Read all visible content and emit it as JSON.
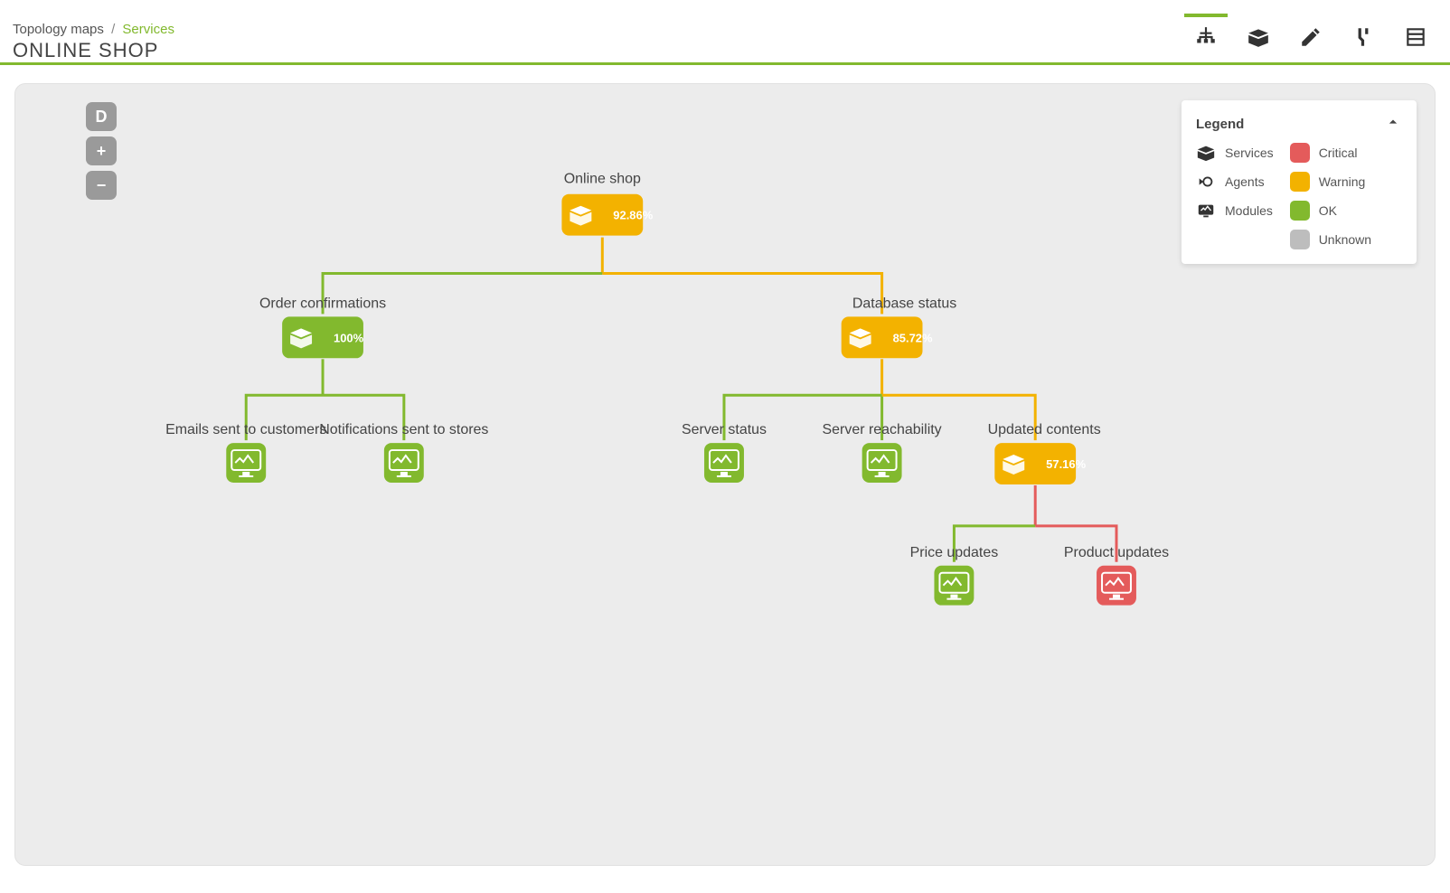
{
  "breadcrumb": {
    "root": "Topology maps",
    "current": "Services"
  },
  "title": "ONLINE SHOP",
  "legend": {
    "title": "Legend",
    "types": [
      {
        "label": "Services"
      },
      {
        "label": "Agents"
      },
      {
        "label": "Modules"
      }
    ],
    "statuses": [
      {
        "label": "Critical",
        "key": "critical"
      },
      {
        "label": "Warning",
        "key": "warning"
      },
      {
        "label": "OK",
        "key": "ok"
      },
      {
        "label": "Unknown",
        "key": "unknown"
      }
    ]
  },
  "zoom": {
    "default": "D",
    "in": "+",
    "out": "−"
  },
  "colors": {
    "ok": "#82b92e",
    "warning": "#f3b200",
    "critical": "#e45b5b",
    "unknown": "#bdbdbd"
  },
  "nodes": {
    "root": {
      "label": "Online shop",
      "pct": "92.86%",
      "type": "service",
      "status": "warning"
    },
    "orders": {
      "label": "Order confirmations",
      "pct": "100%",
      "type": "service",
      "status": "ok"
    },
    "db": {
      "label": "Database status",
      "pct": "85.72%",
      "type": "service",
      "status": "warning"
    },
    "emails": {
      "label": "Emails sent to customers",
      "type": "module",
      "status": "ok"
    },
    "notif": {
      "label": "Notifications sent to stores",
      "type": "module",
      "status": "ok"
    },
    "srvstat": {
      "label": "Server status",
      "type": "module",
      "status": "ok"
    },
    "srvreach": {
      "label": "Server reachability",
      "type": "module",
      "status": "ok"
    },
    "updated": {
      "label": "Updated contents",
      "pct": "57.16%",
      "type": "service",
      "status": "warning"
    },
    "price": {
      "label": "Price updates",
      "type": "module",
      "status": "ok"
    },
    "product": {
      "label": "Product updates",
      "type": "module",
      "status": "critical"
    }
  }
}
